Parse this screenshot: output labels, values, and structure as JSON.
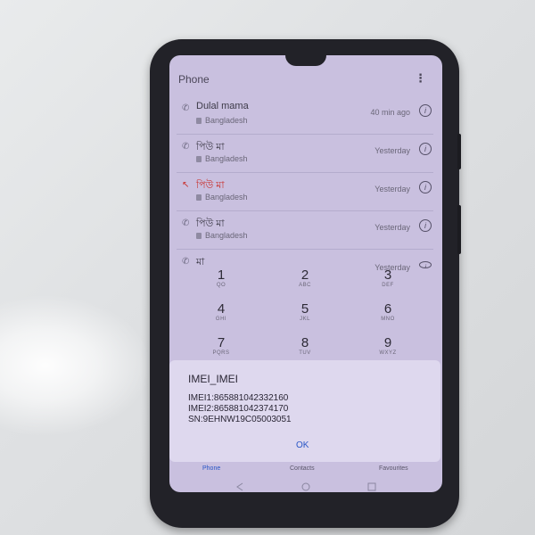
{
  "app": {
    "title": "Phone",
    "more_icon": "more-vert-icon"
  },
  "calls": [
    {
      "name": "Dulal mama",
      "location": "Bangladesh",
      "time": "40 min ago",
      "missed": false
    },
    {
      "name": "পিউ মা",
      "location": "Bangladesh",
      "time": "Yesterday",
      "missed": false
    },
    {
      "name": "পিউ মা",
      "location": "Bangladesh",
      "time": "Yesterday",
      "missed": true
    },
    {
      "name": "পিউ মা",
      "location": "Bangladesh",
      "time": "Yesterday",
      "missed": false
    },
    {
      "name": "মা",
      "location": "",
      "time": "Yesterday",
      "missed": false
    }
  ],
  "keypad": [
    {
      "digit": "1",
      "letters": "QO"
    },
    {
      "digit": "2",
      "letters": "ABC"
    },
    {
      "digit": "3",
      "letters": "DEF"
    },
    {
      "digit": "4",
      "letters": "GHI"
    },
    {
      "digit": "5",
      "letters": "JKL"
    },
    {
      "digit": "6",
      "letters": "MNO"
    },
    {
      "digit": "7",
      "letters": "PQRS"
    },
    {
      "digit": "8",
      "letters": "TUV"
    },
    {
      "digit": "9",
      "letters": "WXYZ"
    }
  ],
  "tabs": {
    "phone": "Phone",
    "contacts": "Contacts",
    "favourites": "Favourites"
  },
  "dialog": {
    "title": "IMEI_IMEI",
    "imei1": "IMEI1:865881042332160",
    "imei2": "IMEI2:865881042374170",
    "sn": "SN:9EHNW19C05003051",
    "ok": "OK"
  },
  "colors": {
    "screen_bg": "#c9c0df",
    "accent": "#2a56c6",
    "missed": "#c9302c"
  }
}
